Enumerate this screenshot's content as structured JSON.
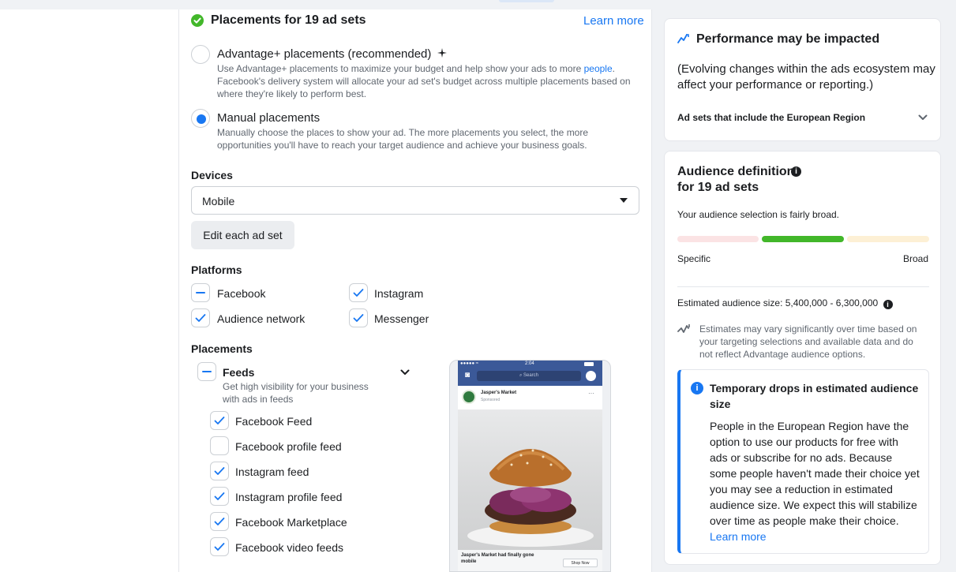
{
  "placements": {
    "title": "Placements for 19 ad sets",
    "learn_more": "Learn more",
    "advantage": {
      "title": "Advantage+ placements (recommended)",
      "desc_before_link": "Use Advantage+ placements to maximize your budget and help show your ads to more ",
      "desc_link": "people",
      "desc_after_link": ".",
      "desc_line2": "Facebook's delivery system will allocate your ad set's budget across multiple placements based on",
      "desc_line3": "where they're likely to perform best."
    },
    "manual": {
      "title": "Manual placements",
      "desc_line1": "Manually choose the places to show your ad. The more placements you select, the more",
      "desc_line2": "opportunities you'll have to reach your target audience and achieve your business goals."
    },
    "devices_label": "Devices",
    "devices_value": "Mobile",
    "edit_button": "Edit each ad set",
    "platforms_label": "Platforms",
    "platforms": [
      {
        "label": "Facebook",
        "state": "indeterminate"
      },
      {
        "label": "Instagram",
        "state": "checked"
      },
      {
        "label": "Audience network",
        "state": "checked"
      },
      {
        "label": "Messenger",
        "state": "checked"
      }
    ],
    "placements_label": "Placements",
    "feeds": {
      "title": "Feeds",
      "desc_line1": "Get high visibility for your business",
      "desc_line2": "with ads in feeds"
    },
    "feed_items": [
      {
        "label": "Facebook Feed",
        "checked": true
      },
      {
        "label": "Facebook profile feed",
        "checked": false
      },
      {
        "label": "Instagram feed",
        "checked": true
      },
      {
        "label": "Instagram profile feed",
        "checked": true
      },
      {
        "label": "Facebook Marketplace",
        "checked": true
      },
      {
        "label": "Facebook video feeds",
        "checked": true
      }
    ],
    "preview": {
      "time": "2:04",
      "search": "Search",
      "page_name": "Jasper's Market",
      "sponsored": "Sponsored",
      "caption_line1": "Jasper's Market had finally gone",
      "caption_line2": "mobile",
      "cta": "Shop Now"
    }
  },
  "performance": {
    "title": "Performance may be impacted",
    "body_line1": "(Evolving changes within the ads ecosystem may",
    "body_line2": "affect your performance or reporting.)",
    "expander": "Ad sets that include the European Region"
  },
  "audience": {
    "title_line1": "Audience definition",
    "title_line2": "for 19 ad sets",
    "selection_text": "Your audience selection is fairly broad.",
    "meter_left": "Specific",
    "meter_right": "Broad",
    "estimated_size": "Estimated audience size: 5,400,000 - 6,300,000",
    "note_line1": "Estimates may vary significantly over time based on",
    "note_line2": "your targeting selections and available data and do",
    "note_line3": "not reflect Advantage audience options.",
    "notice_title_line1": "Temporary drops in estimated audience",
    "notice_title_line2": "size",
    "notice_lines": [
      "People in the European Region have the",
      "option to use our products for free with",
      "ads or subscribe for no ads. Because",
      "some people haven't made their choice yet",
      "you may see a reduction in estimated",
      "audience size. We expect this will stabilize",
      "over time as people make their choice."
    ],
    "notice_link": "Learn more"
  },
  "colors": {
    "accent": "#1877f2",
    "success": "#42b72a",
    "meter_active": "#42b72a",
    "meter_left": "#fbe3e4",
    "meter_right": "#fdf0d5"
  }
}
